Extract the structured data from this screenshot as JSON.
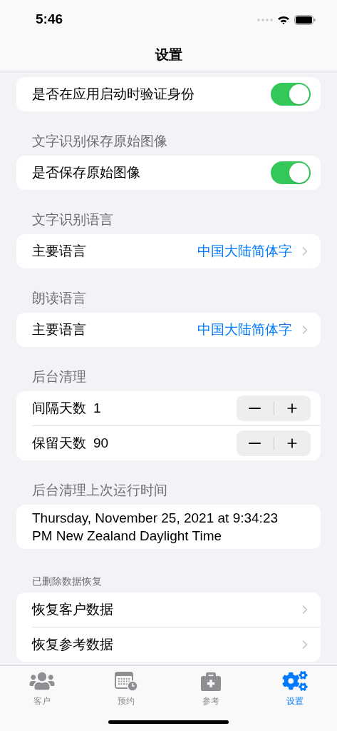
{
  "status_bar": {
    "time": "5:46"
  },
  "nav": {
    "title": "设置"
  },
  "sections": [
    {
      "rows": [
        {
          "kind": "toggle",
          "label": "是否在应用启动时验证身份",
          "on": true
        }
      ]
    },
    {
      "header": "文字识别保存原始图像",
      "kind": "large",
      "rows": [
        {
          "kind": "toggle",
          "label": "是否保存原始图像",
          "on": true
        }
      ]
    },
    {
      "header": "文字识别语言",
      "kind": "large",
      "rows": [
        {
          "kind": "value_link",
          "label": "主要语言",
          "value": "中国大陆简体字"
        }
      ]
    },
    {
      "header": "朗读语言",
      "kind": "large",
      "rows": [
        {
          "kind": "value_link",
          "label": "主要语言",
          "value": "中国大陆简体字"
        }
      ]
    },
    {
      "header": "后台清理",
      "kind": "large",
      "rows": [
        {
          "kind": "stepper",
          "label": "间隔天数",
          "value": "1"
        },
        {
          "kind": "stepper",
          "label": "保留天数",
          "value": "90"
        }
      ]
    },
    {
      "header": "后台清理上次运行时间",
      "kind": "large",
      "rows": [
        {
          "kind": "text",
          "label": "Thursday, November 25, 2021 at 9:34:23 PM New Zealand Daylight Time"
        }
      ]
    },
    {
      "header": "已删除数据恢复",
      "kind": "small",
      "rows": [
        {
          "kind": "link",
          "label": "恢复客户数据"
        },
        {
          "kind": "link",
          "label": "恢复参考数据"
        }
      ]
    }
  ],
  "tab_bar": [
    {
      "kind": "people",
      "label": "客户",
      "selected": false
    },
    {
      "kind": "calendar",
      "label": "预约",
      "selected": false
    },
    {
      "kind": "medkit",
      "label": "参考",
      "selected": false
    },
    {
      "kind": "gears",
      "label": "设置",
      "selected": true
    }
  ]
}
